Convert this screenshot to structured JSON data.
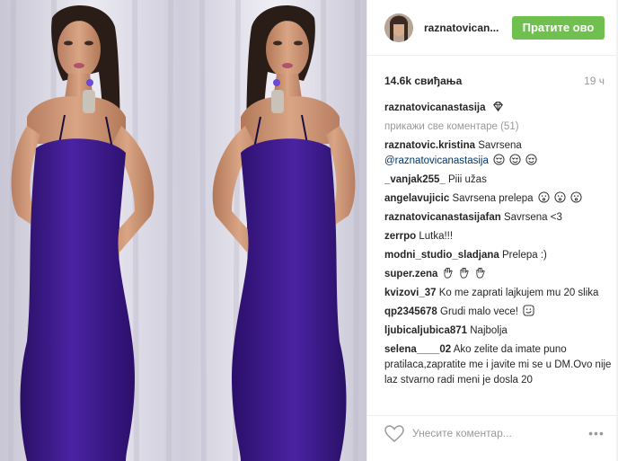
{
  "post": {
    "username": "raznatovican...",
    "follow_label": "Пратите ово",
    "likes": "14.6k свиђања",
    "time": "19 ч"
  },
  "caption": {
    "user": "raznatovicanastasija",
    "icon": "diamond-icon"
  },
  "view_all_comments": "прикажи све коментаре (51)",
  "comments": [
    {
      "user": "raznatovic.kristina",
      "text": "Savrsena",
      "mention": "@raznatovicanastasija",
      "emoji": [
        "heart-eyes",
        "heart-eyes",
        "heart-eyes"
      ]
    },
    {
      "user": "_vanjak255_",
      "text": "Piii užas"
    },
    {
      "user": "angelavujicic",
      "text": "Savrsena prelepa",
      "emoji": [
        "kiss-face",
        "kiss-face",
        "kiss-face"
      ]
    },
    {
      "user": "raznatovicanastasijafan",
      "text": "Savrsena <3"
    },
    {
      "user": "zerrpo",
      "text": "Lutka!!!"
    },
    {
      "user": "modni_studio_sladjana",
      "text": "Prelepa :)"
    },
    {
      "user": "super.zena",
      "text": "",
      "emoji": [
        "hand-icon",
        "hand-icon",
        "hand-icon"
      ]
    },
    {
      "user": "kvizovi_37",
      "text": "Ko me zaprati lajkujem mu 20 slika"
    },
    {
      "user": "qp2345678",
      "text": "Grudi malo vece!",
      "emoji": [
        "smirk-face"
      ]
    },
    {
      "user": "ljubicaljubica871",
      "text": "Najbolja"
    },
    {
      "user": "selena____02",
      "text": "Ako zelite da imate puno pratilaca,zapratite me i javite mi se u DM.Ovo nije laz stvarno radi meni je dosla 20"
    }
  ],
  "footer": {
    "placeholder": "Унесите коментар...",
    "like_icon": "heart-outline-icon",
    "more_icon": "more-options-icon"
  },
  "colors": {
    "follow_green": "#70c050",
    "mention_blue": "#003569",
    "muted_gray": "#999999",
    "dress_purple": "#3d1a86"
  }
}
